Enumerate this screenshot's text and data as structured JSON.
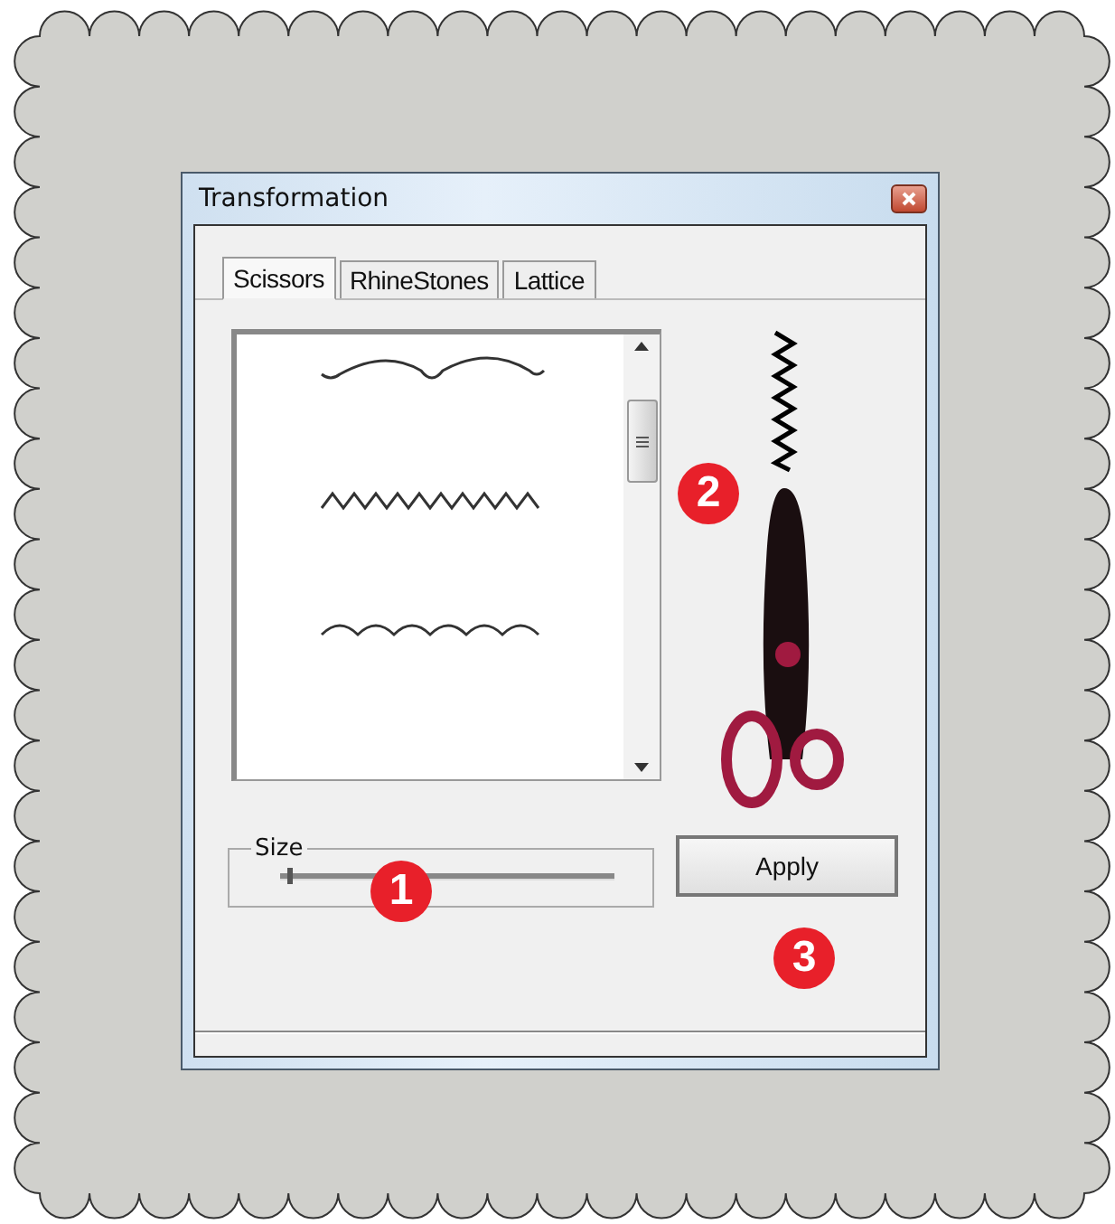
{
  "window": {
    "title": "Transformation"
  },
  "tabs": [
    {
      "label": "Scissors",
      "selected": true
    },
    {
      "label": "RhineStones",
      "selected": false
    },
    {
      "label": "Lattice",
      "selected": false
    }
  ],
  "patterns": [
    {
      "kind": "scallop"
    },
    {
      "kind": "zigzag"
    },
    {
      "kind": "wave"
    }
  ],
  "size": {
    "label": "Size",
    "level": 0.02
  },
  "apply_button": "Apply",
  "callouts": [
    {
      "number": "1"
    },
    {
      "number": "2"
    },
    {
      "number": "3"
    }
  ]
}
